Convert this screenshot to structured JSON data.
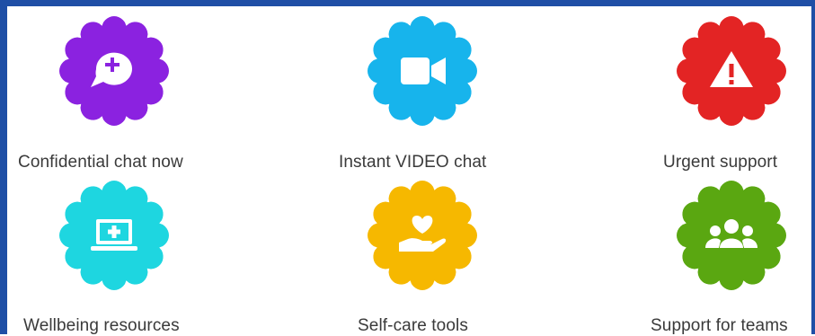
{
  "tiles": [
    {
      "label": "Confidential chat now",
      "icon": "chat-plus-icon",
      "color": "#8b22e0"
    },
    {
      "label": "Instant VIDEO chat",
      "icon": "video-camera-icon",
      "color": "#17b4ec"
    },
    {
      "label": "Urgent support",
      "icon": "warning-icon",
      "color": "#e32424"
    },
    {
      "label": "Wellbeing resources",
      "icon": "laptop-plus-icon",
      "color": "#1ed6e0"
    },
    {
      "label": "Self-care tools",
      "icon": "heart-hand-icon",
      "color": "#f6b800"
    },
    {
      "label": "Support for teams",
      "icon": "team-icon",
      "color": "#5aa711"
    }
  ],
  "frame_color": "#1f4fa6"
}
